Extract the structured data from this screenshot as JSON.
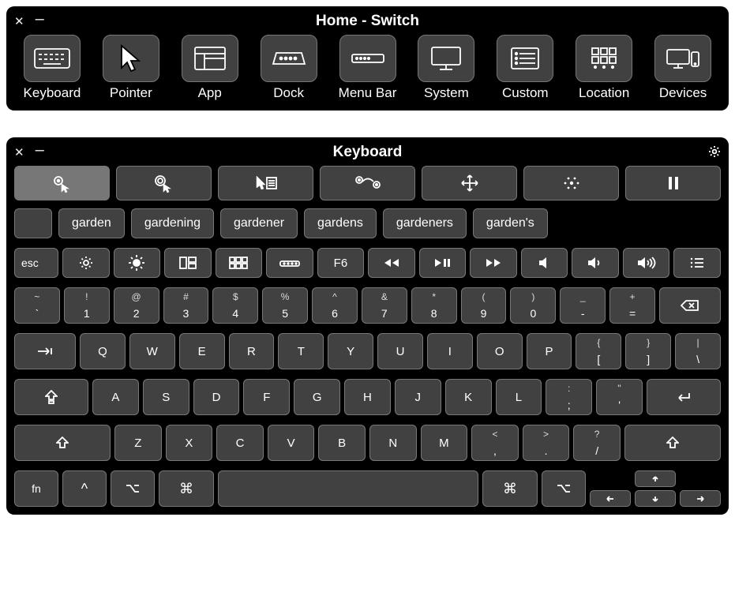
{
  "home": {
    "title": "Home - Switch",
    "items": [
      {
        "label": "Keyboard",
        "icon": "keyboard-icon"
      },
      {
        "label": "Pointer",
        "icon": "pointer-icon"
      },
      {
        "label": "App",
        "icon": "app-window-icon"
      },
      {
        "label": "Dock",
        "icon": "dock-icon"
      },
      {
        "label": "Menu Bar",
        "icon": "menu-bar-icon"
      },
      {
        "label": "System",
        "icon": "monitor-icon"
      },
      {
        "label": "Custom",
        "icon": "list-icon"
      },
      {
        "label": "Location",
        "icon": "grid-icon"
      },
      {
        "label": "Devices",
        "icon": "devices-icon"
      }
    ]
  },
  "keyboard": {
    "title": "Keyboard",
    "actions": [
      {
        "name": "click-target-icon",
        "active": true
      },
      {
        "name": "double-click-icon",
        "active": false
      },
      {
        "name": "context-menu-icon",
        "active": false
      },
      {
        "name": "drag-drop-icon",
        "active": false
      },
      {
        "name": "move-icon",
        "active": false
      },
      {
        "name": "scatter-icon",
        "active": false
      },
      {
        "name": "pause-icon",
        "active": false
      }
    ],
    "suggestions": [
      "garden",
      "gardening",
      "gardener",
      "gardens",
      "gardeners",
      "garden's"
    ],
    "fn_row": [
      {
        "label": "esc",
        "icon": null
      },
      {
        "label": "",
        "icon": "brightness-down-icon"
      },
      {
        "label": "",
        "icon": "brightness-up-icon"
      },
      {
        "label": "",
        "icon": "mission-control-left-icon"
      },
      {
        "label": "",
        "icon": "mission-control-icon"
      },
      {
        "label": "",
        "icon": "keyboard-light-icon"
      },
      {
        "label": "F6",
        "icon": null
      },
      {
        "label": "",
        "icon": "rewind-icon"
      },
      {
        "label": "",
        "icon": "play-pause-icon"
      },
      {
        "label": "",
        "icon": "forward-icon"
      },
      {
        "label": "",
        "icon": "mute-icon"
      },
      {
        "label": "",
        "icon": "volume-down-icon"
      },
      {
        "label": "",
        "icon": "volume-up-icon"
      },
      {
        "label": "",
        "icon": "list-small-icon"
      }
    ],
    "num_row": [
      {
        "top": "~",
        "bot": "`"
      },
      {
        "top": "!",
        "bot": "1"
      },
      {
        "top": "@",
        "bot": "2"
      },
      {
        "top": "#",
        "bot": "3"
      },
      {
        "top": "$",
        "bot": "4"
      },
      {
        "top": "%",
        "bot": "5"
      },
      {
        "top": "^",
        "bot": "6"
      },
      {
        "top": "&",
        "bot": "7"
      },
      {
        "top": "*",
        "bot": "8"
      },
      {
        "top": "(",
        "bot": "9"
      },
      {
        "top": ")",
        "bot": "0"
      },
      {
        "top": "_",
        "bot": "-"
      },
      {
        "top": "+",
        "bot": "="
      }
    ],
    "backspace_icon": "backspace-icon",
    "tab_icon": "tab-icon",
    "q_row": [
      "Q",
      "W",
      "E",
      "R",
      "T",
      "Y",
      "U",
      "I",
      "O",
      "P"
    ],
    "q_row_end": [
      {
        "top": "{",
        "bot": "["
      },
      {
        "top": "}",
        "bot": "]"
      },
      {
        "top": "|",
        "bot": "\\"
      }
    ],
    "caps_icon": "caps-icon",
    "a_row": [
      "A",
      "S",
      "D",
      "F",
      "G",
      "H",
      "J",
      "K",
      "L"
    ],
    "a_row_end": [
      {
        "top": ":",
        "bot": ";"
      },
      {
        "top": "\"",
        "bot": "'"
      }
    ],
    "return_icon": "return-icon",
    "shift_icon": "shift-icon",
    "z_row": [
      "Z",
      "X",
      "C",
      "V",
      "B",
      "N",
      "M"
    ],
    "z_row_end": [
      {
        "top": "<",
        "bot": ","
      },
      {
        "top": ">",
        "bot": "."
      },
      {
        "top": "?",
        "bot": "/"
      }
    ],
    "mod_row": {
      "fn": "fn",
      "ctrl": "^",
      "opt_icon": "option-icon",
      "cmd": "⌘"
    },
    "arrows": {
      "up": "arrow-up-icon",
      "down": "arrow-down-icon",
      "left": "arrow-left-icon",
      "right": "arrow-right-icon"
    }
  }
}
